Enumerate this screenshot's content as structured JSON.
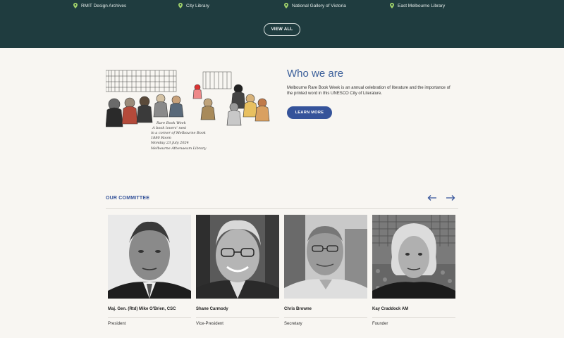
{
  "venues": {
    "items": [
      {
        "label": "RMIT Design Archives"
      },
      {
        "label": "City Library"
      },
      {
        "label": "National Gallery of Victoria"
      },
      {
        "label": "East Melbourne Library"
      }
    ],
    "view_all_label": "VIEW ALL",
    "pin_color": "#9ecf6a",
    "band_color": "#1f3c3f"
  },
  "who_we_are": {
    "title": "Who we are",
    "text": "Melbourne Rare Book Week is an annual celebration of literature and the importance of the printed word in this UNESCO City of Literature.",
    "button_label": "LEARN MORE",
    "sketch_caption_lines": [
      "Rare Book Week",
      "A book lovers' nest",
      "in a corner of Melbourne Book",
      "1880 Room",
      "Monday 23 July 2024",
      "Melbourne Athenaeum Library"
    ]
  },
  "committee": {
    "heading": "OUR COMMITTEE",
    "prev_icon": "arrow-left-icon",
    "next_icon": "arrow-right-icon",
    "members": [
      {
        "name": "Maj. Gen. (Rtd) Mike O'Brien, CSC",
        "role": "President"
      },
      {
        "name": "Shane Carmody",
        "role": "Vice-President"
      },
      {
        "name": "Chris Browne",
        "role": "Secretary"
      },
      {
        "name": "Kay Craddock AM",
        "role": "Founder"
      }
    ]
  },
  "colors": {
    "accent": "#35539a",
    "title_blue": "#3b5f9a",
    "background": "#f8f6f2"
  }
}
